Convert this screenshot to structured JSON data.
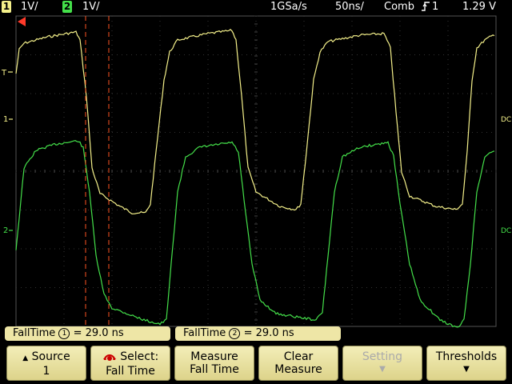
{
  "topbar": {
    "ch1_number": "1",
    "ch1_scale": "1V/",
    "ch2_number": "2",
    "ch2_scale": "1V/",
    "sample_rate": "1GSa/s",
    "timebase": "50ns/",
    "acq_mode": "Comb",
    "trigger_source": "1",
    "trigger_level": "1.29 V"
  },
  "markers": {
    "trigger_level": "T",
    "ch1_ground": "1",
    "ch2_ground": "2",
    "coupling_1": "DC",
    "coupling_2": "DC"
  },
  "measurements": [
    {
      "label": "FallTime",
      "channel": "1",
      "value": "= 29.0 ns"
    },
    {
      "label": "FallTime",
      "channel": "2",
      "value": "= 29.0 ns"
    }
  ],
  "softkeys": [
    {
      "line1": "Source",
      "line2": "1",
      "icon": "up-arrow-icon",
      "enabled": true
    },
    {
      "line1": "Select:",
      "line2": "Fall Time",
      "icon": "entry-knob-icon",
      "enabled": true
    },
    {
      "line1": "Measure",
      "line2": "Fall Time",
      "enabled": true
    },
    {
      "line1": "Clear",
      "line2": "Measure",
      "enabled": true
    },
    {
      "line1": "Setting",
      "line2": "",
      "icon": "down-arrow-icon",
      "enabled": false
    },
    {
      "line1": "Thresholds",
      "line2": "",
      "icon": "down-arrow-icon",
      "enabled": true
    }
  ],
  "colors": {
    "ch1": "#f4f08a",
    "ch2": "#44e04a",
    "cursor": "#ff5522",
    "softkey": "#efe8a8"
  }
}
